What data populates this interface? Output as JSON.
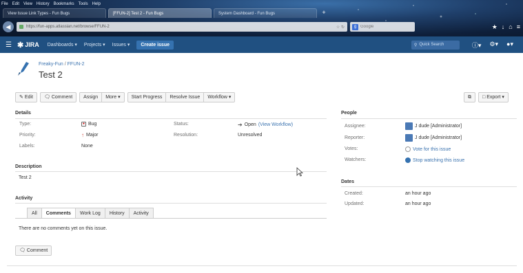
{
  "browser": {
    "menu": [
      "File",
      "Edit",
      "View",
      "History",
      "Bookmarks",
      "Tools",
      "Help"
    ],
    "tabs": [
      {
        "label": "View Issue Link Types - Fun Bugs"
      },
      {
        "label": "[FFUN-2] Test 2 - Fun Bugs"
      },
      {
        "label": "System Dashboard - Fun Bugs"
      }
    ],
    "new_tab": "+",
    "url": "https://fun-apps.atlassian.net/browse/FFUN-2",
    "search_placeholder": "Google"
  },
  "header": {
    "logo_text": "JIRA",
    "nav": [
      "Dashboards ▾",
      "Projects ▾",
      "Issues ▾"
    ],
    "create_label": "Create issue",
    "quick_search_placeholder": "Quick Search"
  },
  "issue": {
    "project": "Freaky-Fun",
    "key": "FFUN-2",
    "summary": "Test 2"
  },
  "toolbar": {
    "edit": "Edit",
    "comment": "Comment",
    "assign": "Assign",
    "more": "More ▾",
    "start_progress": "Start Progress",
    "resolve": "Resolve Issue",
    "workflow": "Workflow ▾",
    "export": "Export ▾"
  },
  "details": {
    "title": "Details",
    "type_label": "Type:",
    "type_value": "Bug",
    "priority_label": "Priority:",
    "priority_value": "Major",
    "labels_label": "Labels:",
    "labels_value": "None",
    "status_label": "Status:",
    "status_value": "Open",
    "view_workflow": "(View Workflow)",
    "resolution_label": "Resolution:",
    "resolution_value": "Unresolved"
  },
  "description": {
    "title": "Description",
    "text": "Test 2"
  },
  "activity": {
    "title": "Activity",
    "tabs": [
      "All",
      "Comments",
      "Work Log",
      "History",
      "Activity"
    ],
    "active_tab": "Comments",
    "empty_text": "There are no comments yet on this issue.",
    "comment_button": "Comment"
  },
  "people": {
    "title": "People",
    "assignee_label": "Assignee:",
    "assignee_value": "J dude [Administrator]",
    "reporter_label": "Reporter:",
    "reporter_value": "J dude [Administrator]",
    "votes_label": "Votes:",
    "votes_value": "Vote for this issue",
    "watchers_label": "Watchers:",
    "watchers_value": "Stop watching this issue"
  },
  "dates": {
    "title": "Dates",
    "created_label": "Created:",
    "created_value": "an hour ago",
    "updated_label": "Updated:",
    "updated_value": "an hour ago"
  },
  "colors": {
    "header_bg": "#205081",
    "link": "#3b73af",
    "create_button": "#3572b0"
  }
}
